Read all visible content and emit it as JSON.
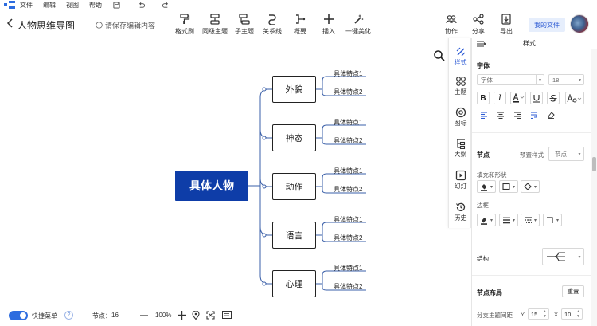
{
  "menu": {
    "items": [
      "文件",
      "编辑",
      "视图",
      "帮助"
    ]
  },
  "header": {
    "title": "人物思维导图",
    "save_hint": "请保存编辑内容"
  },
  "toolbar": {
    "tools": [
      {
        "id": "format-brush",
        "label": "格式刷"
      },
      {
        "id": "same-level-topic",
        "label": "同级主题"
      },
      {
        "id": "sub-topic",
        "label": "子主题"
      },
      {
        "id": "relation",
        "label": "关系线"
      },
      {
        "id": "summary",
        "label": "概要"
      },
      {
        "id": "insert",
        "label": "插入"
      },
      {
        "id": "beautify",
        "label": "一键美化"
      }
    ],
    "right_tools": [
      {
        "id": "collaborate",
        "label": "协作"
      },
      {
        "id": "share",
        "label": "分享"
      },
      {
        "id": "export",
        "label": "导出"
      }
    ],
    "my_file_label": "我的文件"
  },
  "mindmap": {
    "root": "具体人物",
    "branches": [
      {
        "label": "外貌",
        "leaves": [
          "具体特点1",
          "具体特点2"
        ]
      },
      {
        "label": "神态",
        "leaves": [
          "具体特点1",
          "具体特点2"
        ]
      },
      {
        "label": "动作",
        "leaves": [
          "具体特点1",
          "具体特点2"
        ]
      },
      {
        "label": "语言",
        "leaves": [
          "具体特点1",
          "具体特点2"
        ]
      },
      {
        "label": "心理",
        "leaves": [
          "具体特点1",
          "具体特点2"
        ]
      }
    ]
  },
  "side_tabs": [
    {
      "id": "style",
      "label": "样式",
      "active": true
    },
    {
      "id": "theme",
      "label": "主题"
    },
    {
      "id": "icon",
      "label": "图标"
    },
    {
      "id": "outline",
      "label": "大纲"
    },
    {
      "id": "slides",
      "label": "幻灯"
    },
    {
      "id": "history",
      "label": "历史"
    }
  ],
  "panel": {
    "title": "样式",
    "font_section": "字体",
    "font_family_placeholder": "字体",
    "font_size": "18",
    "node_section": "节点",
    "preset_label": "预置样式",
    "preset_value": "节点",
    "fill_shape_label": "填充和形状",
    "border_label": "边框",
    "structure_label": "结构",
    "layout_section": "节点布局",
    "reset_label": "重置",
    "spacing_label": "分支主题间距",
    "y_label": "Y",
    "y_value": "15",
    "x_label": "X",
    "x_value": "10"
  },
  "status": {
    "quick_menu_label": "快捷菜单",
    "help_symbol": "?",
    "node_count_label": "节点：",
    "node_count": "16",
    "zoom": "100%"
  },
  "colors": {
    "accent": "#2d5bd4",
    "root_bg": "#0e3da8",
    "line": "#3a5fa8"
  }
}
